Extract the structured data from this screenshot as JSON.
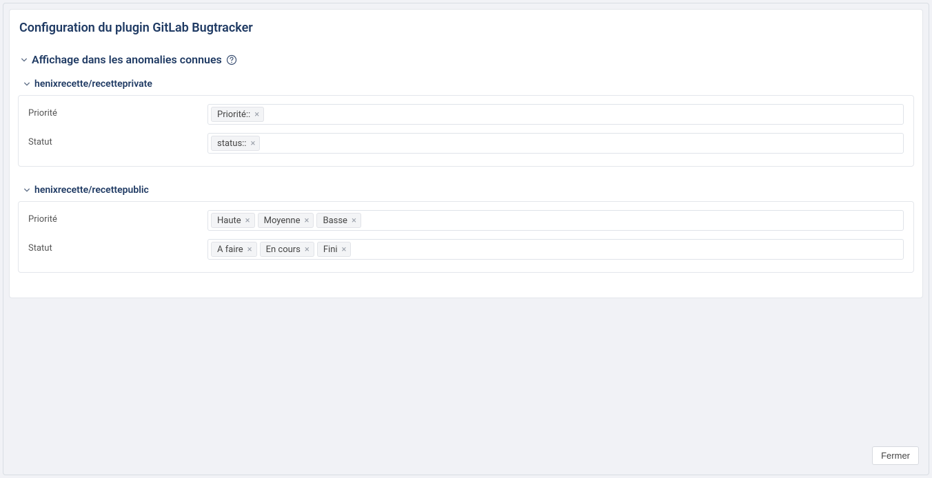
{
  "title": "Configuration du plugin GitLab Bugtracker",
  "section": {
    "label": "Affichage dans les anomalies connues"
  },
  "labels": {
    "priority": "Priorité",
    "status": "Statut"
  },
  "projects": [
    {
      "name": "henixrecette/recetteprivate",
      "priority_tags": [
        "Priorité::"
      ],
      "status_tags": [
        "status::"
      ]
    },
    {
      "name": "henixrecette/recettepublic",
      "priority_tags": [
        "Haute",
        "Moyenne",
        "Basse"
      ],
      "status_tags": [
        "A faire",
        "En cours",
        "Fini"
      ]
    }
  ],
  "footer": {
    "close_label": "Fermer"
  }
}
